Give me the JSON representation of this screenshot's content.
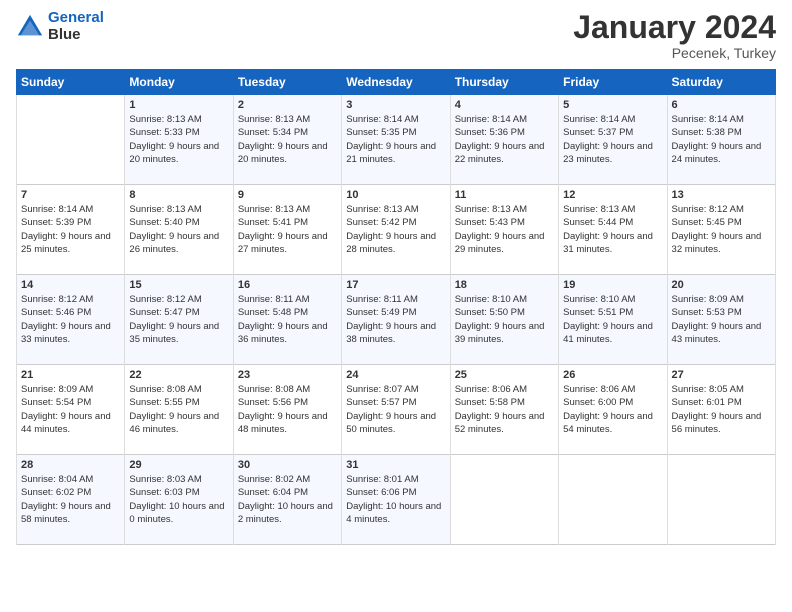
{
  "header": {
    "logo_line1": "General",
    "logo_line2": "Blue",
    "month": "January 2024",
    "location": "Pecenek, Turkey"
  },
  "days_of_week": [
    "Sunday",
    "Monday",
    "Tuesday",
    "Wednesday",
    "Thursday",
    "Friday",
    "Saturday"
  ],
  "weeks": [
    [
      {
        "day": "",
        "sunrise": "",
        "sunset": "",
        "daylight": ""
      },
      {
        "day": "1",
        "sunrise": "Sunrise: 8:13 AM",
        "sunset": "Sunset: 5:33 PM",
        "daylight": "Daylight: 9 hours and 20 minutes."
      },
      {
        "day": "2",
        "sunrise": "Sunrise: 8:13 AM",
        "sunset": "Sunset: 5:34 PM",
        "daylight": "Daylight: 9 hours and 20 minutes."
      },
      {
        "day": "3",
        "sunrise": "Sunrise: 8:14 AM",
        "sunset": "Sunset: 5:35 PM",
        "daylight": "Daylight: 9 hours and 21 minutes."
      },
      {
        "day": "4",
        "sunrise": "Sunrise: 8:14 AM",
        "sunset": "Sunset: 5:36 PM",
        "daylight": "Daylight: 9 hours and 22 minutes."
      },
      {
        "day": "5",
        "sunrise": "Sunrise: 8:14 AM",
        "sunset": "Sunset: 5:37 PM",
        "daylight": "Daylight: 9 hours and 23 minutes."
      },
      {
        "day": "6",
        "sunrise": "Sunrise: 8:14 AM",
        "sunset": "Sunset: 5:38 PM",
        "daylight": "Daylight: 9 hours and 24 minutes."
      }
    ],
    [
      {
        "day": "7",
        "sunrise": "Sunrise: 8:14 AM",
        "sunset": "Sunset: 5:39 PM",
        "daylight": "Daylight: 9 hours and 25 minutes."
      },
      {
        "day": "8",
        "sunrise": "Sunrise: 8:13 AM",
        "sunset": "Sunset: 5:40 PM",
        "daylight": "Daylight: 9 hours and 26 minutes."
      },
      {
        "day": "9",
        "sunrise": "Sunrise: 8:13 AM",
        "sunset": "Sunset: 5:41 PM",
        "daylight": "Daylight: 9 hours and 27 minutes."
      },
      {
        "day": "10",
        "sunrise": "Sunrise: 8:13 AM",
        "sunset": "Sunset: 5:42 PM",
        "daylight": "Daylight: 9 hours and 28 minutes."
      },
      {
        "day": "11",
        "sunrise": "Sunrise: 8:13 AM",
        "sunset": "Sunset: 5:43 PM",
        "daylight": "Daylight: 9 hours and 29 minutes."
      },
      {
        "day": "12",
        "sunrise": "Sunrise: 8:13 AM",
        "sunset": "Sunset: 5:44 PM",
        "daylight": "Daylight: 9 hours and 31 minutes."
      },
      {
        "day": "13",
        "sunrise": "Sunrise: 8:12 AM",
        "sunset": "Sunset: 5:45 PM",
        "daylight": "Daylight: 9 hours and 32 minutes."
      }
    ],
    [
      {
        "day": "14",
        "sunrise": "Sunrise: 8:12 AM",
        "sunset": "Sunset: 5:46 PM",
        "daylight": "Daylight: 9 hours and 33 minutes."
      },
      {
        "day": "15",
        "sunrise": "Sunrise: 8:12 AM",
        "sunset": "Sunset: 5:47 PM",
        "daylight": "Daylight: 9 hours and 35 minutes."
      },
      {
        "day": "16",
        "sunrise": "Sunrise: 8:11 AM",
        "sunset": "Sunset: 5:48 PM",
        "daylight": "Daylight: 9 hours and 36 minutes."
      },
      {
        "day": "17",
        "sunrise": "Sunrise: 8:11 AM",
        "sunset": "Sunset: 5:49 PM",
        "daylight": "Daylight: 9 hours and 38 minutes."
      },
      {
        "day": "18",
        "sunrise": "Sunrise: 8:10 AM",
        "sunset": "Sunset: 5:50 PM",
        "daylight": "Daylight: 9 hours and 39 minutes."
      },
      {
        "day": "19",
        "sunrise": "Sunrise: 8:10 AM",
        "sunset": "Sunset: 5:51 PM",
        "daylight": "Daylight: 9 hours and 41 minutes."
      },
      {
        "day": "20",
        "sunrise": "Sunrise: 8:09 AM",
        "sunset": "Sunset: 5:53 PM",
        "daylight": "Daylight: 9 hours and 43 minutes."
      }
    ],
    [
      {
        "day": "21",
        "sunrise": "Sunrise: 8:09 AM",
        "sunset": "Sunset: 5:54 PM",
        "daylight": "Daylight: 9 hours and 44 minutes."
      },
      {
        "day": "22",
        "sunrise": "Sunrise: 8:08 AM",
        "sunset": "Sunset: 5:55 PM",
        "daylight": "Daylight: 9 hours and 46 minutes."
      },
      {
        "day": "23",
        "sunrise": "Sunrise: 8:08 AM",
        "sunset": "Sunset: 5:56 PM",
        "daylight": "Daylight: 9 hours and 48 minutes."
      },
      {
        "day": "24",
        "sunrise": "Sunrise: 8:07 AM",
        "sunset": "Sunset: 5:57 PM",
        "daylight": "Daylight: 9 hours and 50 minutes."
      },
      {
        "day": "25",
        "sunrise": "Sunrise: 8:06 AM",
        "sunset": "Sunset: 5:58 PM",
        "daylight": "Daylight: 9 hours and 52 minutes."
      },
      {
        "day": "26",
        "sunrise": "Sunrise: 8:06 AM",
        "sunset": "Sunset: 6:00 PM",
        "daylight": "Daylight: 9 hours and 54 minutes."
      },
      {
        "day": "27",
        "sunrise": "Sunrise: 8:05 AM",
        "sunset": "Sunset: 6:01 PM",
        "daylight": "Daylight: 9 hours and 56 minutes."
      }
    ],
    [
      {
        "day": "28",
        "sunrise": "Sunrise: 8:04 AM",
        "sunset": "Sunset: 6:02 PM",
        "daylight": "Daylight: 9 hours and 58 minutes."
      },
      {
        "day": "29",
        "sunrise": "Sunrise: 8:03 AM",
        "sunset": "Sunset: 6:03 PM",
        "daylight": "Daylight: 10 hours and 0 minutes."
      },
      {
        "day": "30",
        "sunrise": "Sunrise: 8:02 AM",
        "sunset": "Sunset: 6:04 PM",
        "daylight": "Daylight: 10 hours and 2 minutes."
      },
      {
        "day": "31",
        "sunrise": "Sunrise: 8:01 AM",
        "sunset": "Sunset: 6:06 PM",
        "daylight": "Daylight: 10 hours and 4 minutes."
      },
      {
        "day": "",
        "sunrise": "",
        "sunset": "",
        "daylight": ""
      },
      {
        "day": "",
        "sunrise": "",
        "sunset": "",
        "daylight": ""
      },
      {
        "day": "",
        "sunrise": "",
        "sunset": "",
        "daylight": ""
      }
    ]
  ]
}
